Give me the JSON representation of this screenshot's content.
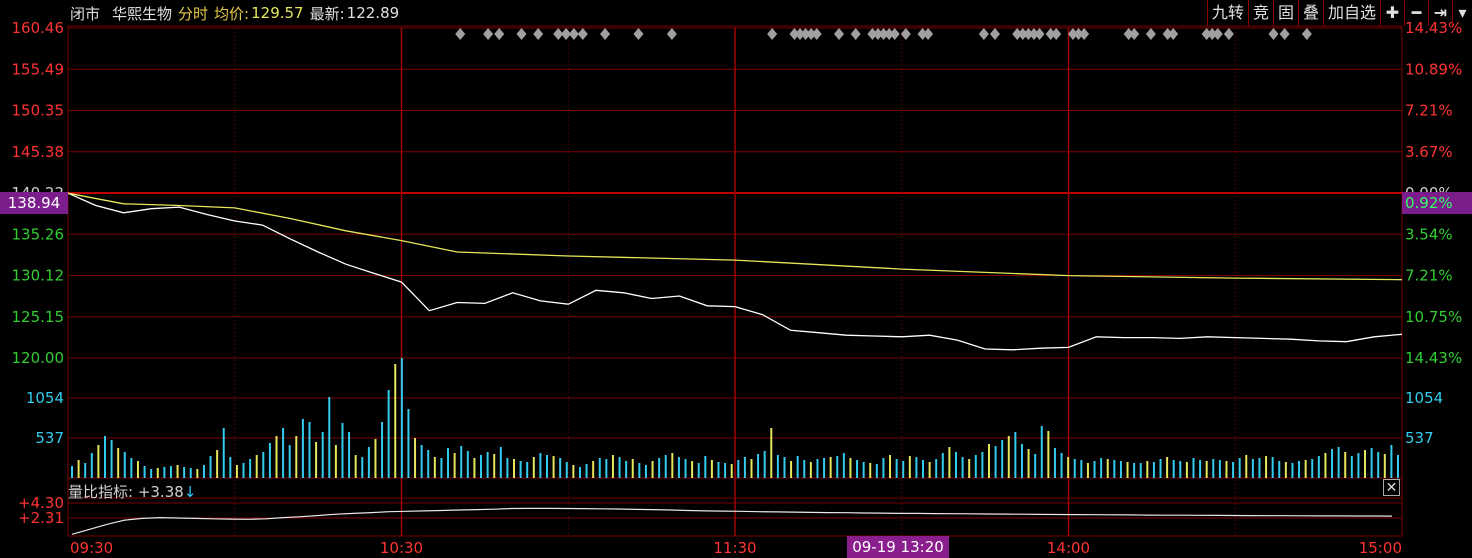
{
  "header": {
    "status": "闭市",
    "stock_name": "华熙生物",
    "mode": "分时",
    "avg_label": "均价:",
    "avg_value": "129.57",
    "last_label": "最新:",
    "last_value": "122.89"
  },
  "toolbar": {
    "items": [
      {
        "label": "九转",
        "icon": "nine-turn"
      },
      {
        "label": "竞",
        "icon": "auction"
      },
      {
        "label": "固",
        "icon": "fixed"
      },
      {
        "label": "叠",
        "icon": "overlay"
      },
      {
        "label": "加自选",
        "icon": "add-watchlist"
      },
      {
        "label": "✚",
        "icon": "plus-icon"
      },
      {
        "label": "━",
        "icon": "minus-icon"
      },
      {
        "label": "⇥",
        "icon": "arrow-to-end-icon"
      },
      {
        "label": "▾",
        "icon": "dropdown-icon"
      }
    ]
  },
  "price_badge": {
    "left": "138.94",
    "right": "0.92%"
  },
  "indicator": {
    "label": "量比指标: +3.38",
    "arrow": "↓"
  },
  "volume_ticks": [
    "1054",
    "537"
  ],
  "indicator_ticks": [
    "+4.30",
    "+2.31"
  ],
  "time_tag": "09-19 13:20",
  "colors": {
    "up": "#ff3333",
    "down": "#33cc33",
    "grid": "#7a0000",
    "price": "#ffffff",
    "avg": "#e6e65a",
    "vol_cyan": "#33ccee",
    "vol_yellow": "#e6e65a"
  },
  "chart_data": {
    "type": "line",
    "x_ticks": [
      "09:30",
      "10:30",
      "11:30",
      "14:00",
      "15:00"
    ],
    "price_axis_left": [
      "160.46",
      "155.49",
      "150.35",
      "145.38",
      "140.22",
      "135.26",
      "130.12",
      "125.15",
      "120.00"
    ],
    "price_axis_right": [
      "14.43%",
      "10.89%",
      "7.21%",
      "3.67%",
      "0.00%",
      "3.54%",
      "7.21%",
      "10.75%",
      "14.43%"
    ],
    "ylim": [
      120.0,
      160.46
    ],
    "prev_close": 140.22,
    "series": [
      {
        "name": "price",
        "time": [
          "09:30",
          "09:35",
          "09:40",
          "09:45",
          "09:50",
          "09:55",
          "10:00",
          "10:05",
          "10:10",
          "10:15",
          "10:20",
          "10:25",
          "10:30",
          "10:35",
          "10:40",
          "10:45",
          "10:50",
          "10:55",
          "11:00",
          "11:05",
          "11:10",
          "11:15",
          "11:20",
          "11:25",
          "11:30",
          "13:05",
          "13:10",
          "13:15",
          "13:20",
          "13:25",
          "13:30",
          "13:35",
          "13:40",
          "13:45",
          "13:50",
          "13:55",
          "14:00",
          "14:05",
          "14:10",
          "14:15",
          "14:20",
          "14:25",
          "14:30",
          "14:35",
          "14:40",
          "14:45",
          "14:50",
          "14:55",
          "15:00"
        ],
        "values": [
          140.2,
          138.7,
          137.8,
          138.3,
          138.5,
          137.6,
          136.8,
          136.3,
          134.6,
          133.0,
          131.5,
          130.4,
          129.3,
          125.8,
          126.8,
          126.7,
          128.0,
          127.0,
          126.6,
          128.3,
          128.0,
          127.3,
          127.6,
          126.4,
          126.3,
          125.3,
          123.4,
          123.1,
          122.8,
          122.7,
          122.6,
          122.8,
          122.2,
          121.1,
          121.0,
          121.2,
          121.3,
          122.6,
          122.5,
          122.5,
          122.4,
          122.6,
          122.5,
          122.4,
          122.3,
          122.1,
          122.0,
          122.6,
          122.9
        ]
      },
      {
        "name": "均价",
        "time": [
          "09:30",
          "09:40",
          "09:50",
          "10:00",
          "10:10",
          "10:20",
          "10:30",
          "10:40",
          "11:00",
          "11:30",
          "13:30",
          "14:00",
          "14:30",
          "15:00"
        ],
        "values": [
          140.2,
          138.9,
          138.7,
          138.4,
          137.1,
          135.6,
          134.4,
          133.0,
          132.5,
          132.0,
          130.9,
          130.1,
          129.8,
          129.6
        ]
      }
    ],
    "volume": {
      "ylim": [
        0,
        1200
      ],
      "values": [
        120,
        180,
        150,
        250,
        330,
        420,
        380,
        300,
        260,
        200,
        170,
        120,
        90,
        100,
        110,
        120,
        130,
        110,
        100,
        90,
        130,
        220,
        280,
        500,
        210,
        130,
        150,
        190,
        230,
        260,
        350,
        420,
        500,
        330,
        420,
        590,
        560,
        360,
        460,
        810,
        330,
        550,
        460,
        230,
        210,
        310,
        390,
        560,
        880,
        1140,
        1200,
        690,
        400,
        330,
        280,
        210,
        200,
        300,
        250,
        320,
        270,
        200,
        230,
        260,
        240,
        310,
        200,
        190,
        170,
        160,
        210,
        250,
        230,
        220,
        200,
        160,
        130,
        110,
        140,
        170,
        200,
        190,
        230,
        210,
        170,
        190,
        150,
        130,
        170,
        200,
        230,
        250,
        210,
        190,
        170,
        150,
        220,
        180,
        160,
        150,
        140,
        180,
        210,
        190,
        240,
        270,
        500,
        230,
        210,
        170,
        220,
        180,
        160,
        190,
        200,
        210,
        220,
        250,
        200,
        180,
        160,
        150,
        140,
        200,
        230,
        190,
        170,
        220,
        210,
        180,
        160,
        190,
        250,
        310,
        260,
        210,
        190,
        230,
        260,
        340,
        320,
        380,
        420,
        460,
        340,
        290,
        240,
        520,
        470,
        300,
        250,
        210,
        190,
        180,
        150,
        170,
        200,
        190,
        180,
        170,
        160,
        150,
        150,
        170,
        160,
        190,
        210,
        180,
        170,
        160,
        200,
        180,
        170,
        190,
        180,
        170,
        160,
        200,
        230,
        190,
        200,
        220,
        210,
        170,
        160,
        150,
        170,
        180,
        190,
        220,
        250,
        290,
        310,
        260,
        220,
        250,
        280,
        300,
        260,
        240,
        330,
        230
      ]
    },
    "indicator_series": {
      "ylim": [
        1.0,
        5.3
      ],
      "values": [
        1.2,
        1.8,
        2.4,
        2.9,
        3.1,
        3.2,
        3.15,
        3.1,
        3.05,
        3.02,
        3.0,
        3.05,
        3.2,
        3.3,
        3.45,
        3.6,
        3.7,
        3.8,
        3.9,
        3.95,
        4.0,
        4.05,
        4.1,
        4.15,
        4.2,
        4.28,
        4.3,
        4.3,
        4.28,
        4.27,
        4.25,
        4.22,
        4.18,
        4.15,
        4.1,
        4.05,
        4.0,
        3.98,
        3.95,
        3.9,
        3.88,
        3.85,
        3.82,
        3.8,
        3.78,
        3.75,
        3.73,
        3.7,
        3.7,
        3.68,
        3.66,
        3.65,
        3.63,
        3.62,
        3.6,
        3.58,
        3.57,
        3.56,
        3.55,
        3.53,
        3.52,
        3.5,
        3.49,
        3.48,
        3.47,
        3.46,
        3.45,
        3.44,
        3.43,
        3.42,
        3.41,
        3.4,
        3.4,
        3.39,
        3.39,
        3.38
      ]
    }
  }
}
